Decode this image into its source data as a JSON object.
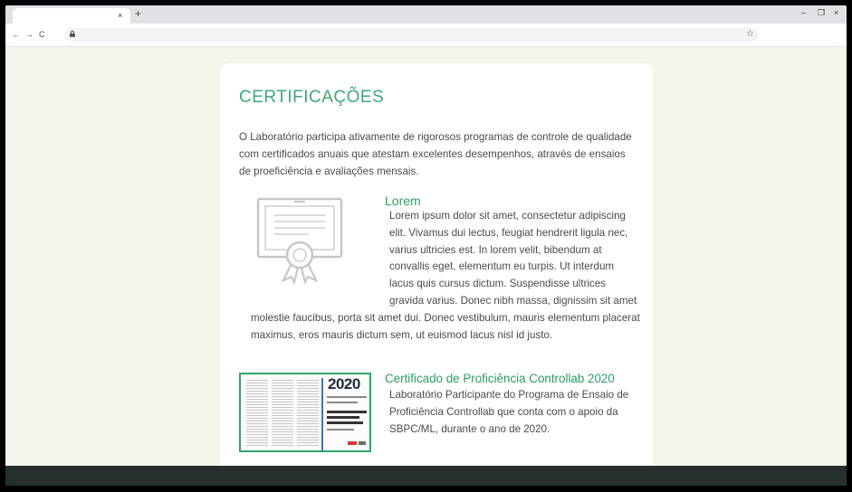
{
  "browser": {
    "tab": {
      "close": "×"
    },
    "new_tab": "+",
    "window": {
      "minimize": "–",
      "maximize": "❐",
      "close": "×"
    },
    "nav": {
      "back": "←",
      "forward": "→",
      "reload": "C"
    },
    "bookmark": "☆"
  },
  "page": {
    "title": "CERTIFICAÇÕES",
    "intro": "O Laboratório participa ativamente de rigorosos programas de controle de qualidade com certificados anuais que atestam excelentes desempenhos, através de ensaios de proeficiência e avaliações mensais.",
    "section1": {
      "heading": "Lorem",
      "text": "Lorem ipsum dolor sit amet, consectetur adipiscing elit. Vivamus dui lectus, feugiat hendrerit ligula nec, varius ultricies est. In lorem velit, bibendum at convallis eget, elementum eu turpis. Ut interdum lacus quis cursus dictum. Suspendisse ultrices gravida varius. Donec nibh massa, dignissim sit amet molestie faucibus, porta sit amet dui. Donec vestibulum, mauris elementum placerat maximus, eros mauris dictum sem, ut euismod lacus nisl id justo.",
      "icon": "certificate-icon"
    },
    "section2": {
      "heading": "Certificado de Proficiência Controllab 2020",
      "text": "Laboratório Participante do Programa de Ensaio de Proficiência Controllab que conta com o apoio da SBPC/ML, durante o ano de 2020.",
      "thumbnail_year": "2020"
    }
  },
  "colors": {
    "accent": "#3daa76",
    "heading_green": "#2a9d63",
    "page_bg": "#f4f4ec",
    "footer": "#26302c"
  }
}
